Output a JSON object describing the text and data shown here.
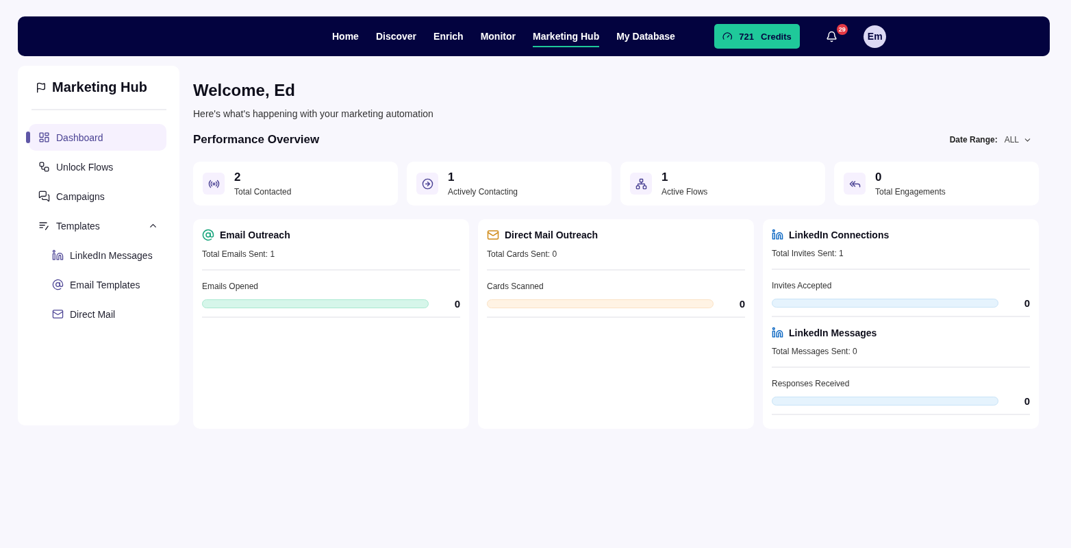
{
  "nav": {
    "items": [
      {
        "label": "Home",
        "selected": false
      },
      {
        "label": "Discover",
        "selected": false
      },
      {
        "label": "Enrich",
        "selected": false
      },
      {
        "label": "Monitor",
        "selected": false
      },
      {
        "label": "Marketing Hub",
        "selected": true
      },
      {
        "label": "My Database",
        "selected": false
      }
    ],
    "credits": {
      "amount": "721",
      "label": "Credits"
    },
    "notifications": "29",
    "avatar": "Em"
  },
  "sidebar": {
    "title": "Marketing Hub",
    "items": [
      {
        "label": "Dashboard",
        "kind": "dashboard",
        "selected": true
      },
      {
        "label": "Unlock Flows",
        "kind": "flows",
        "selected": false
      },
      {
        "label": "Campaigns",
        "kind": "campaigns",
        "selected": false
      },
      {
        "label": "Templates",
        "kind": "templates",
        "selected": false,
        "expanded": true,
        "children": [
          {
            "label": "LinkedIn Messages",
            "kind": "linkedin",
            "selected": false
          },
          {
            "label": "Email Templates",
            "kind": "email",
            "selected": false
          },
          {
            "label": "Direct Mail",
            "kind": "mail",
            "selected": false
          }
        ]
      }
    ]
  },
  "header": {
    "title": "Welcome, Ed",
    "subtitle": "Here's what's happening with your marketing automation"
  },
  "overview": {
    "title": "Performance Overview",
    "date_range_label": "Date Range:",
    "date_range_value": "ALL",
    "stats": [
      {
        "value": "2",
        "label": "Total Contacted",
        "kind": "contacted"
      },
      {
        "value": "1",
        "label": "Actively Contacting",
        "kind": "active"
      },
      {
        "value": "1",
        "label": "Active Flows",
        "kind": "flows"
      },
      {
        "value": "0",
        "label": "Total Engagements",
        "kind": "engagements"
      }
    ]
  },
  "columns": [
    {
      "sections": [
        {
          "kind": "email",
          "title": "Email Outreach",
          "total": "Total Emails Sent: 1",
          "metric": "Emails Opened",
          "level": 0,
          "count": "0"
        }
      ]
    },
    {
      "sections": [
        {
          "kind": "mail",
          "title": "Direct Mail Outreach",
          "total": "Total Cards Sent: 0",
          "metric": "Cards Scanned",
          "level": 0,
          "count": "0"
        }
      ]
    },
    {
      "sections": [
        {
          "kind": "linkedin",
          "title": "LinkedIn Connections",
          "total": "Total Invites Sent: 1",
          "metric": "Invites Accepted",
          "level": 0,
          "count": "0"
        },
        {
          "kind": "linkedin",
          "title": "LinkedIn Messages",
          "total": "Total Messages Sent: 0",
          "metric": "Responses Received",
          "level": 0,
          "count": "0"
        }
      ]
    }
  ]
}
